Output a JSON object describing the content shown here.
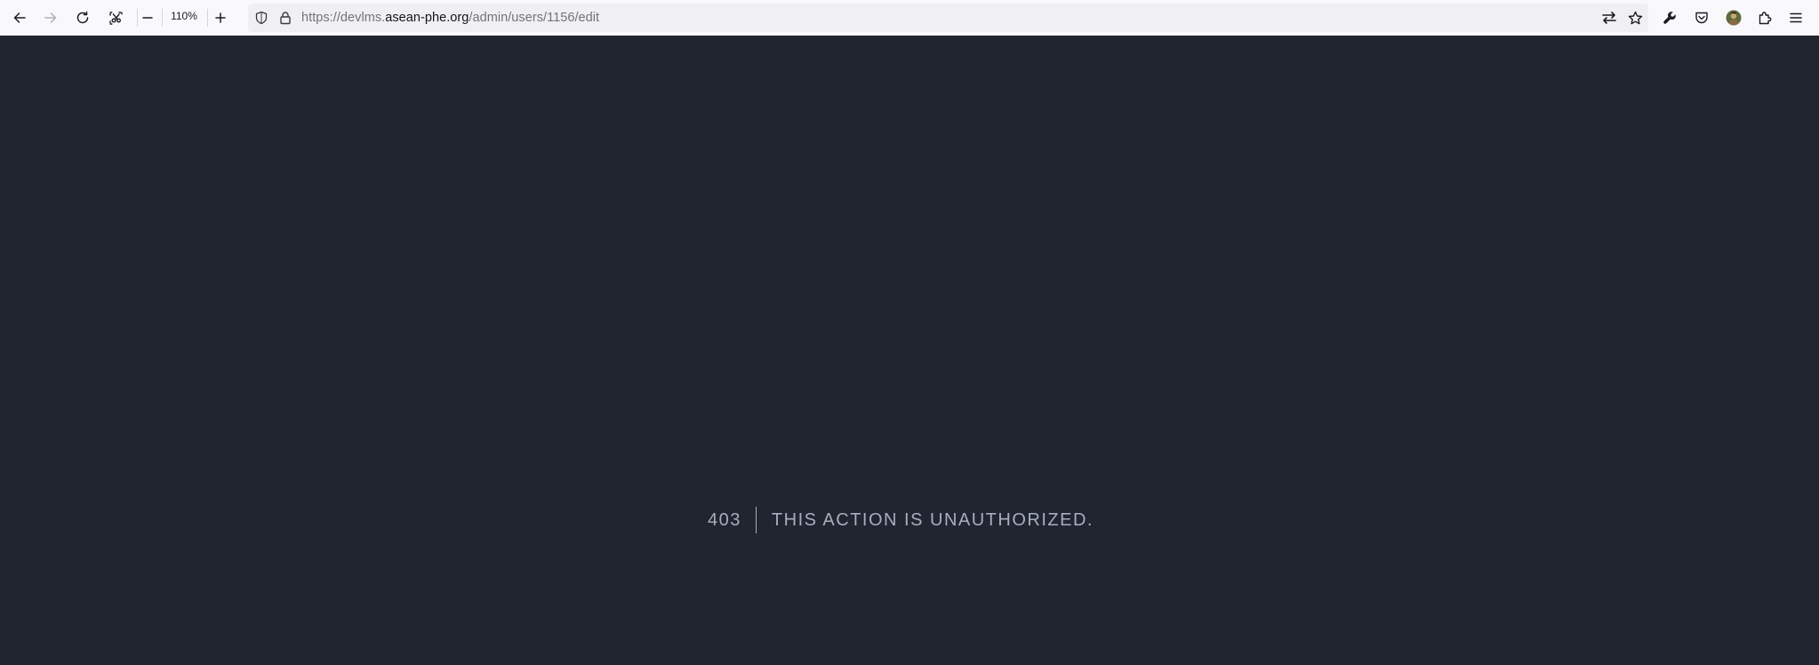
{
  "browser": {
    "zoom_level": "110%",
    "url": {
      "prefix": "https://devlms.",
      "host": "asean-phe.org",
      "path": "/admin/users/1156/edit"
    },
    "icons": {
      "back": "arrow-left-icon",
      "forward": "arrow-right-icon",
      "reload": "reload-icon",
      "screenshot": "screenshot-icon",
      "zoom_out": "minus-icon",
      "zoom_in": "plus-icon",
      "tracking": "shield-icon",
      "security": "lock-icon",
      "translate": "swap-arrows-icon",
      "bookmark": "star-icon",
      "devtools": "wrench-icon",
      "pocket": "pocket-icon",
      "profile": "avatar-icon",
      "extensions": "puzzle-icon",
      "menu": "hamburger-icon"
    }
  },
  "page": {
    "error_code": "403",
    "error_message": "This action is unauthorized.",
    "colors": {
      "background": "#212530",
      "text": "#a6aebf"
    }
  }
}
